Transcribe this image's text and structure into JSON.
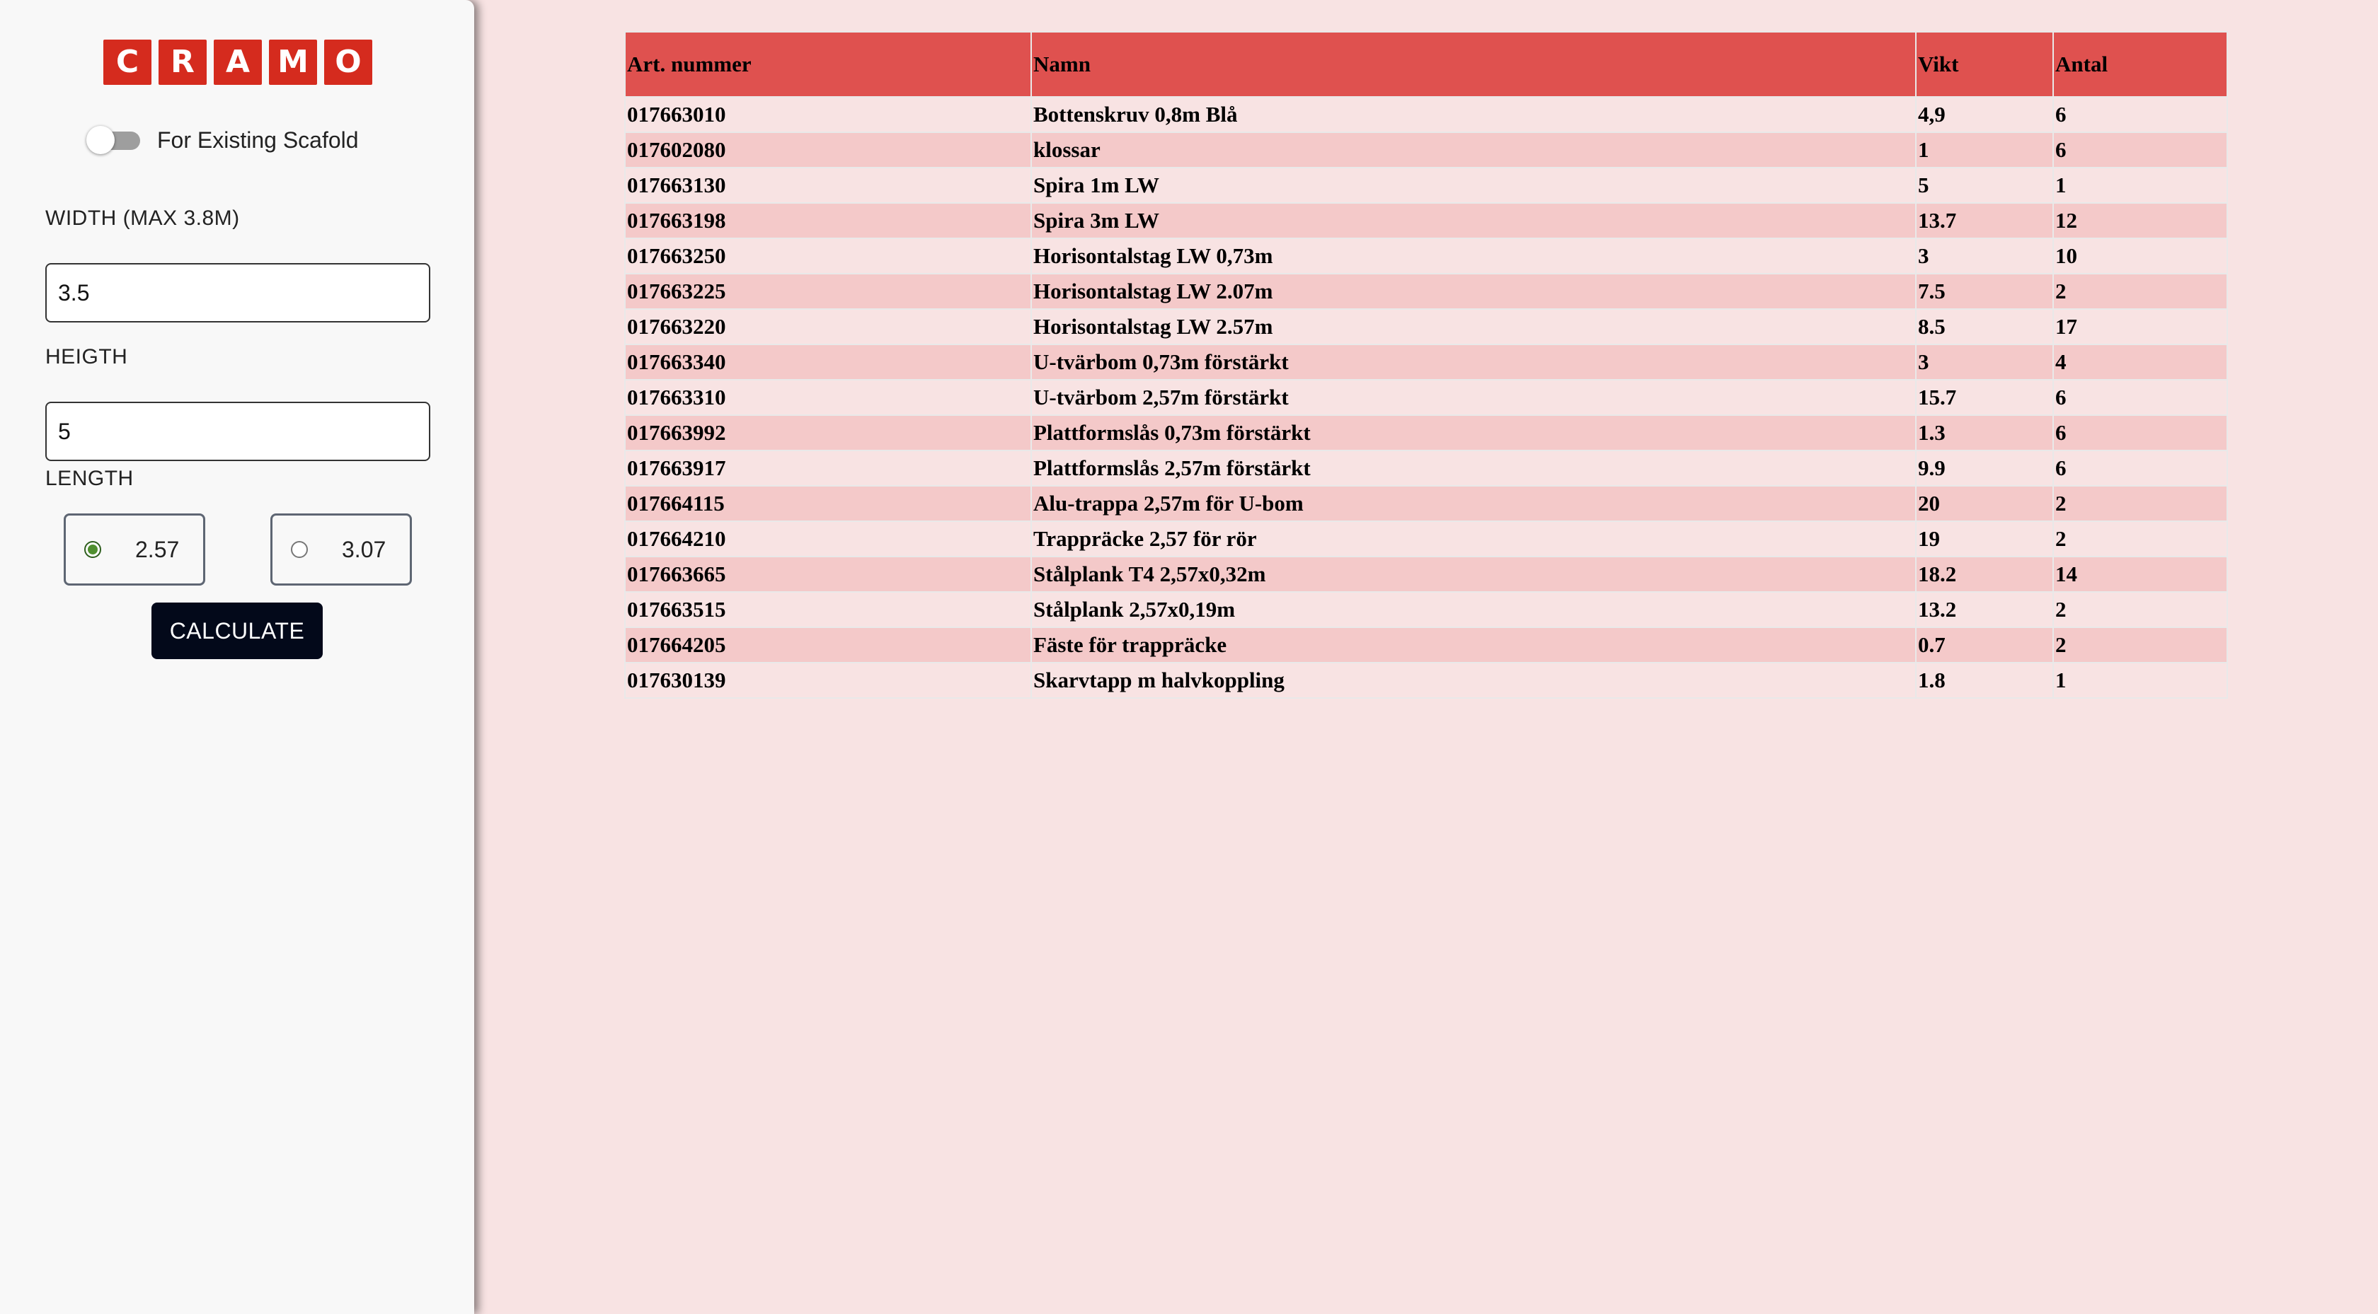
{
  "sidebar": {
    "logo_letters": [
      "C",
      "R",
      "A",
      "M",
      "O"
    ],
    "existing_toggle": {
      "label": "For Existing Scafold",
      "on": false
    },
    "width": {
      "label": "WIDTH (MAX 3.8M)",
      "value": "3.5"
    },
    "height": {
      "label": "HEIGTH",
      "value": "5"
    },
    "length": {
      "label": "LENGTH",
      "options": [
        {
          "label": "2.57",
          "selected": true
        },
        {
          "label": "3.07",
          "selected": false
        }
      ]
    },
    "calculate_label": "CALCULATE"
  },
  "table": {
    "headers": [
      "Art. nummer",
      "Namn",
      "Vikt",
      "Antal"
    ],
    "rows": [
      [
        "017663010",
        "Bottenskruv 0,8m Blå",
        "4,9",
        "6"
      ],
      [
        "017602080",
        "klossar",
        "1",
        "6"
      ],
      [
        "017663130",
        "Spira 1m LW",
        "5",
        "1"
      ],
      [
        "017663198",
        "Spira 3m LW",
        "13.7",
        "12"
      ],
      [
        "017663250",
        "Horisontalstag LW 0,73m",
        "3",
        "10"
      ],
      [
        "017663225",
        "Horisontalstag LW 2.07m",
        "7.5",
        "2"
      ],
      [
        "017663220",
        "Horisontalstag LW 2.57m",
        "8.5",
        "17"
      ],
      [
        "017663340",
        "U-tvärbom 0,73m förstärkt",
        "3",
        "4"
      ],
      [
        "017663310",
        "U-tvärbom 2,57m förstärkt",
        "15.7",
        "6"
      ],
      [
        "017663992",
        "Plattformslås 0,73m förstärkt",
        "1.3",
        "6"
      ],
      [
        "017663917",
        "Plattformslås 2,57m förstärkt",
        "9.9",
        "6"
      ],
      [
        "017664115",
        "Alu-trappa 2,57m för U-bom",
        "20",
        "2"
      ],
      [
        "017664210",
        "Trappräcke 2,57 för rör",
        "19",
        "2"
      ],
      [
        "017663665",
        "Stålplank T4 2,57x0,32m",
        "18.2",
        "14"
      ],
      [
        "017663515",
        "Stålplank 2,57x0,19m",
        "13.2",
        "2"
      ],
      [
        "017664205",
        "Fäste för trappräcke",
        "0.7",
        "2"
      ],
      [
        "017630139",
        "Skarvtapp m halvkoppling",
        "1.8",
        "1"
      ]
    ]
  },
  "colors": {
    "brand_red": "#d52b1e",
    "header_red": "#df514f",
    "page_bg": "#f8e3e3",
    "row_alt": "#f4c9c9",
    "button_dark": "#03091a",
    "radio_checked": "#4f8f2f"
  }
}
